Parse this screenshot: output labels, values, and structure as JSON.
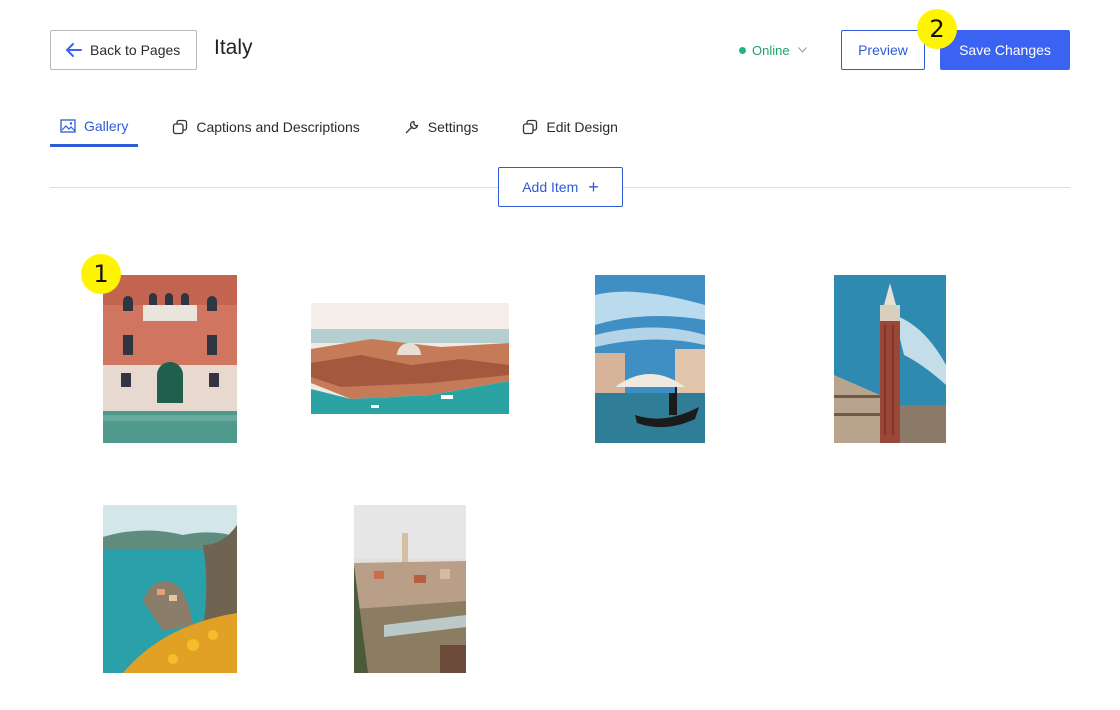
{
  "header": {
    "back_label": "Back to Pages",
    "title": "Italy",
    "status": "Online",
    "preview_label": "Preview",
    "save_label": "Save Changes"
  },
  "tabs": [
    {
      "label": "Gallery",
      "icon": "image-icon",
      "active": true
    },
    {
      "label": "Captions and Descriptions",
      "icon": "overlap-icon",
      "active": false
    },
    {
      "label": "Settings",
      "icon": "wrench-icon",
      "active": false
    },
    {
      "label": "Edit Design",
      "icon": "overlap-icon",
      "active": false
    }
  ],
  "add_item_label": "Add Item",
  "markers": [
    "1",
    "2"
  ],
  "colors": {
    "accent": "#3a63f2",
    "link": "#2f5bd6",
    "status": "#1fb57a",
    "marker": "#fff400"
  },
  "gallery": [
    {
      "subject": "venetian-facade"
    },
    {
      "subject": "venice-aerial"
    },
    {
      "subject": "gondola-canal"
    },
    {
      "subject": "bell-tower"
    },
    {
      "subject": "cliff-village"
    },
    {
      "subject": "hill-town"
    }
  ]
}
